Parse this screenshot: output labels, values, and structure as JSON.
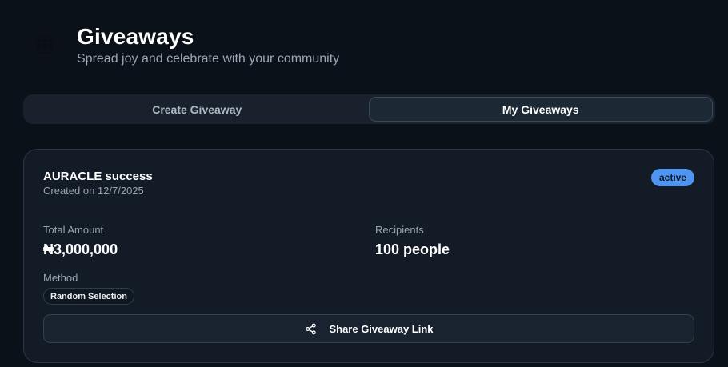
{
  "header": {
    "title": "Giveaways",
    "subtitle": "Spread joy and celebrate with your community",
    "icon": "gift-icon"
  },
  "tabs": [
    {
      "label": "Create Giveaway",
      "active": false
    },
    {
      "label": "My Giveaways",
      "active": true
    }
  ],
  "giveaway": {
    "title": "AURACLE success",
    "created": "Created on 12/7/2025",
    "status": "active",
    "total_amount_label": "Total Amount",
    "total_amount": "₦3,000,000",
    "recipients_label": "Recipients",
    "recipients": "100 people",
    "method_label": "Method",
    "method": "Random Selection",
    "share_label": "Share Giveaway Link",
    "share_icon": "share-icon"
  },
  "colors": {
    "background": "#0b1119",
    "card": "#131c26",
    "status_badge": "#4f94f0"
  }
}
